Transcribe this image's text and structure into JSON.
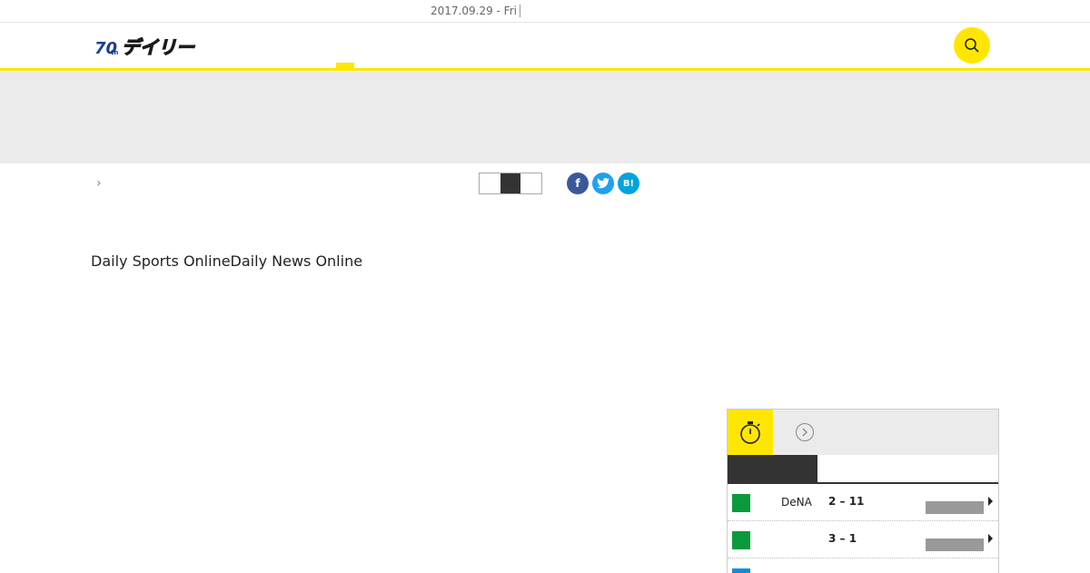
{
  "topbar": {
    "date": "2017.09.29 - Fri"
  },
  "header": {
    "logo_alt": "デイリー",
    "search_icon": "search-icon"
  },
  "colors": {
    "brand_yellow": "#ffe600",
    "facebook": "#3b5998",
    "twitter": "#1da1f2",
    "hatena": "#00a4de"
  },
  "share": {
    "facebook": "f",
    "twitter": "t",
    "hatena": "B!"
  },
  "page_text": "Daily Sports OnlineDaily News Online",
  "scores": {
    "rows": [
      {
        "team": "DeNA",
        "score": "2 – 11",
        "chip_color": "#0a9a3c"
      },
      {
        "team": "",
        "score": "3 – 1",
        "chip_color": "#0a9a3c"
      },
      {
        "team": "",
        "score": "",
        "chip_color": "#0d8fd8"
      }
    ]
  }
}
